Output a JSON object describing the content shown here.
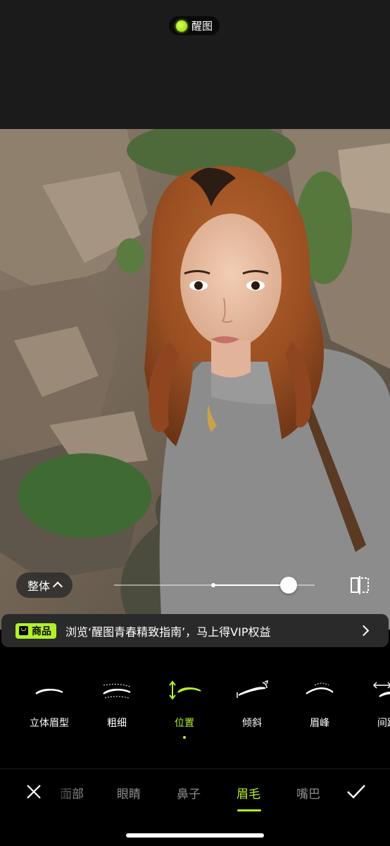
{
  "app": {
    "name": "醒图",
    "accent": "#b3f02a"
  },
  "photo": {
    "description_icon": "portrait-photo"
  },
  "adjust": {
    "scope_label": "整体",
    "slider_value": 0.87,
    "slider_center": 0.49
  },
  "promo": {
    "badge": "商品",
    "text": "浏览‘醒图青春精致指南’，马上得VIP权益"
  },
  "tools": [
    {
      "label": "立体眉型",
      "icon": "brow-3d-icon"
    },
    {
      "label": "粗细",
      "icon": "brow-thickness-icon"
    },
    {
      "label": "位置",
      "icon": "brow-position-icon"
    },
    {
      "label": "倾斜",
      "icon": "brow-tilt-icon"
    },
    {
      "label": "眉峰",
      "icon": "brow-peak-icon"
    },
    {
      "label": "间距",
      "icon": "brow-spacing-icon"
    }
  ],
  "active_tool": "位置",
  "tabs": [
    {
      "label": "面部"
    },
    {
      "label": "眼睛"
    },
    {
      "label": "鼻子"
    },
    {
      "label": "眉毛"
    },
    {
      "label": "嘴巴"
    }
  ],
  "active_tab": "眉毛"
}
